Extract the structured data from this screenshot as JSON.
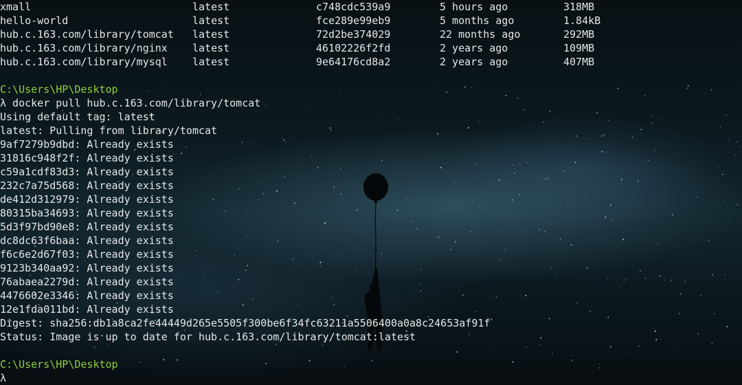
{
  "images_table": [
    {
      "repository": "xmall",
      "tag": "latest",
      "image_id": "c748cdc539a9",
      "created": "5 hours ago",
      "size": "318MB"
    },
    {
      "repository": "hello-world",
      "tag": "latest",
      "image_id": "fce289e99eb9",
      "created": "5 months ago",
      "size": "1.84kB"
    },
    {
      "repository": "hub.c.163.com/library/tomcat",
      "tag": "latest",
      "image_id": "72d2be374029",
      "created": "22 months ago",
      "size": "292MB"
    },
    {
      "repository": "hub.c.163.com/library/nginx",
      "tag": "latest",
      "image_id": "46102226f2fd",
      "created": "2 years ago",
      "size": "109MB"
    },
    {
      "repository": "hub.c.163.com/library/mysql",
      "tag": "latest",
      "image_id": "9e64176cd8a2",
      "created": "2 years ago",
      "size": "407MB"
    }
  ],
  "session": {
    "prompt_path_1": "C:\\Users\\HP\\Desktop",
    "command_line": "λ docker pull hub.c.163.com/library/tomcat",
    "default_tag_msg": "Using default tag: latest",
    "pulling_msg": "latest: Pulling from library/tomcat",
    "layers": [
      "9af7279b9dbd: Already exists",
      "31816c948f2f: Already exists",
      "c59a1cdf83d3: Already exists",
      "232c7a75d568: Already exists",
      "de412d312979: Already exists",
      "80315ba34693: Already exists",
      "5d3f97bd90e8: Already exists",
      "dc8dc63f6baa: Already exists",
      "f6c6e2d67f03: Already exists",
      "9123b340aa92: Already exists",
      "76abaea2279d: Already exists",
      "4476602e3346: Already exists",
      "12e1fda011bd: Already exists"
    ],
    "digest": "Digest: sha256:db1a8ca2fe44449d265e5505f300be6f34fc63211a5506400a0a8c24653af91f",
    "status": "Status: Image is up to date for hub.c.163.com/library/tomcat:latest",
    "prompt_path_2": "C:\\Users\\HP\\Desktop",
    "prompt_symbol": "λ"
  },
  "colors": {
    "prompt_path": "#8fd13a",
    "text": "#e6e6e6"
  }
}
